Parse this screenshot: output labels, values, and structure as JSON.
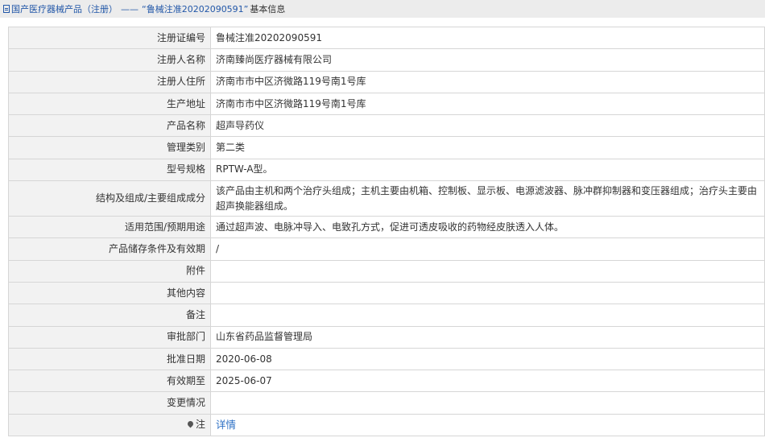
{
  "breadcrumb": {
    "icon": "document-icon",
    "category": "国产医疗器械产品（注册）",
    "separator": "——",
    "current": "“鲁械注准20202090591”",
    "suffix": "基本信息"
  },
  "rows": [
    {
      "label": "注册证编号",
      "value": "鲁械注准20202090591"
    },
    {
      "label": "注册人名称",
      "value": "济南臻尚医疗器械有限公司"
    },
    {
      "label": "注册人住所",
      "value": "济南市市中区济微路119号南1号库"
    },
    {
      "label": "生产地址",
      "value": "济南市市中区济微路119号南1号库"
    },
    {
      "label": "产品名称",
      "value": "超声导药仪"
    },
    {
      "label": "管理类别",
      "value": "第二类"
    },
    {
      "label": "型号规格",
      "value": "RPTW-A型。"
    },
    {
      "label": "结构及组成/主要组成成分",
      "value": "该产品由主机和两个治疗头组成；主机主要由机箱、控制板、显示板、电源滤波器、脉冲群抑制器和变压器组成；治疗头主要由超声换能器组成。"
    },
    {
      "label": "适用范围/预期用途",
      "value": "通过超声波、电脉冲导入、电致孔方式，促进可透皮吸收的药物经皮肤透入人体。"
    },
    {
      "label": "产品储存条件及有效期",
      "value": "/"
    },
    {
      "label": "附件",
      "value": ""
    },
    {
      "label": "其他内容",
      "value": ""
    },
    {
      "label": "备注",
      "value": ""
    },
    {
      "label": "审批部门",
      "value": "山东省药品监督管理局"
    },
    {
      "label": "批准日期",
      "value": "2020-06-08"
    },
    {
      "label": "有效期至",
      "value": "2025-06-07"
    },
    {
      "label": "变更情况",
      "value": ""
    }
  ],
  "note_row": {
    "icon": "pin-icon",
    "label": "注",
    "link_text": "详情"
  }
}
